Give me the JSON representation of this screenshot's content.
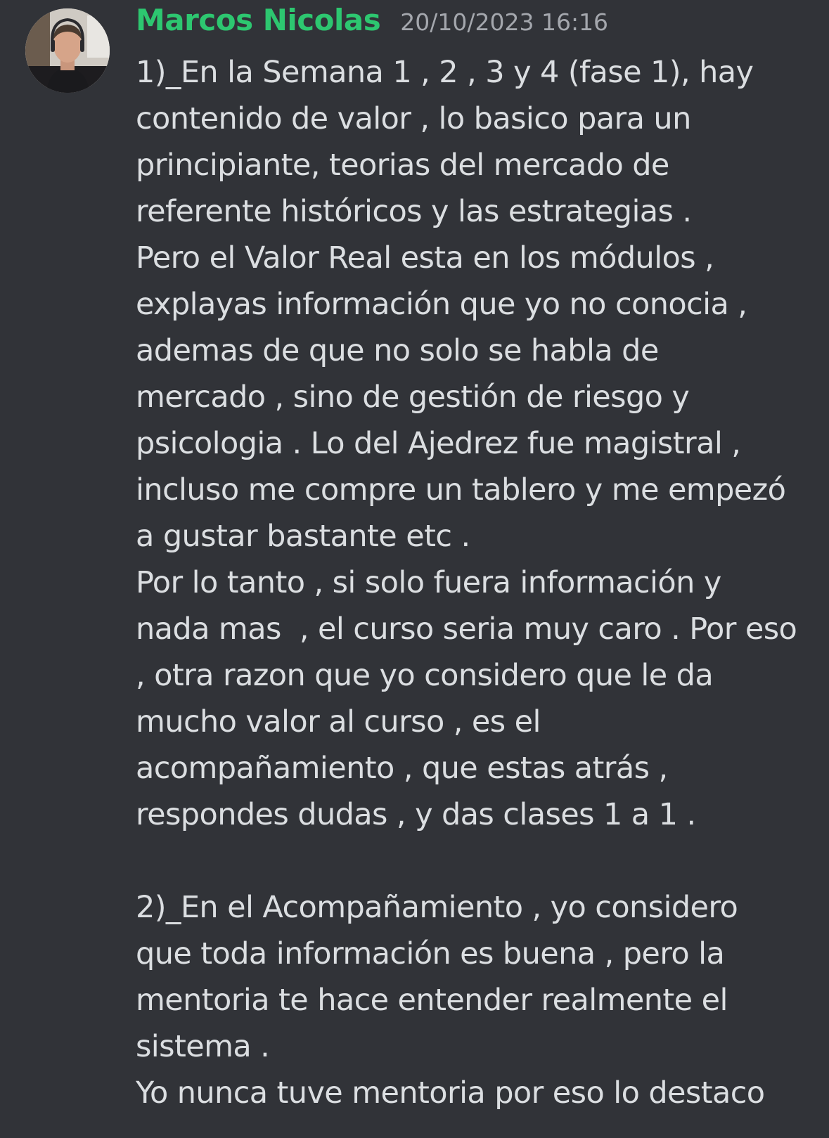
{
  "message": {
    "author": {
      "name": "Marcos Nicolas",
      "name_color": "#2dc770",
      "avatar_icon": "user-avatar-photo"
    },
    "timestamp": "20/10/2023 16:16",
    "lines": [
      "1)_En la Semana 1 , 2 , 3 y 4 (fase 1), hay",
      "contenido de valor , lo basico para un",
      "principiante, teorias del mercado de",
      "referente históricos y las estrategias .",
      "Pero el Valor Real esta en los módulos ,",
      "explayas información que yo no conocia ,",
      "ademas de que no solo se habla de",
      "mercado , sino de gestión de riesgo y",
      "psicologia . Lo del Ajedrez fue magistral ,",
      "incluso me compre un tablero y me empezó",
      "a gustar bastante etc .",
      "Por lo tanto , si solo fuera información y",
      "nada mas  , el curso seria muy caro . Por eso",
      ", otra razon que yo considero que le da",
      "mucho valor al curso , es el",
      "acompañamiento , que estas atrás ,",
      "respondes dudas , y das clases 1 a 1 .",
      "",
      "2)_En el Acompañamiento , yo considero",
      "que toda información es buena , pero la",
      "mentoria te hace entender realmente el",
      "sistema .",
      "Yo nunca tuve mentoria por eso lo destaco"
    ]
  },
  "colors": {
    "background": "#313338",
    "text": "#dbdee1",
    "timestamp": "#a4a7ad"
  }
}
